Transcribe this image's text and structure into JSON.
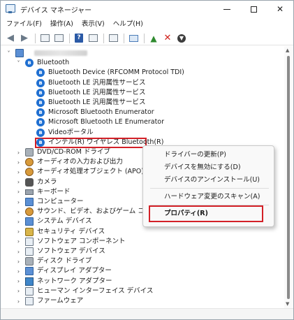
{
  "window": {
    "title": "デバイス マネージャー",
    "controls": {
      "minimize": "—",
      "maximize": "□",
      "close": "✕"
    }
  },
  "menubar": {
    "items": [
      "ファイル(F)",
      "操作(A)",
      "表示(V)",
      "ヘルプ(H)"
    ]
  },
  "toolbar": {
    "icons": [
      "back-arrow-icon",
      "forward-arrow-icon",
      "properties-sheet-icon",
      "console-tree-icon",
      "help-icon",
      "view-icon",
      "scan-hardware-icon",
      "monitor-icon",
      "update-driver-icon",
      "uninstall-icon",
      "disable-icon"
    ]
  },
  "tree": {
    "root_label_obscured": true,
    "bluetooth": {
      "label": "Bluetooth",
      "children": [
        "Bluetooth Device (RFCOMM Protocol TDI)",
        "Bluetooth LE 汎用属性サービス",
        "Bluetooth LE 汎用属性サービス",
        "Bluetooth LE 汎用属性サービス",
        "Microsoft Bluetooth Enumerator",
        "Microsoft Bluetooth LE Enumerator",
        "Videoポータル",
        "インテル(R) ワイヤレス Bluetooth(R)"
      ]
    },
    "categories": [
      "DVD/CD-ROM ドライブ",
      "オーディオの入力および出力",
      "オーディオ処理オブジェクト (APO)",
      "カメラ",
      "キーボード",
      "コンピューター",
      "サウンド、ビデオ、およびゲーム コントローラー",
      "システム デバイス",
      "セキュリティ デバイス",
      "ソフトウェア コンポーネント",
      "ソフトウェア デバイス",
      "ディスク ドライブ",
      "ディスプレイ アダプター",
      "ネットワーク アダプター",
      "ヒューマン インターフェイス デバイス",
      "ファームウェア"
    ]
  },
  "context_menu": {
    "items": [
      "ドライバーの更新(P)",
      "デバイスを無効にする(D)",
      "デバイスのアンインストール(U)",
      "ハードウェア変更のスキャン(A)",
      "プロパティ(R)"
    ]
  },
  "colors": {
    "highlight_red": "#d32027",
    "bluetooth_blue": "#1f6fd1"
  }
}
